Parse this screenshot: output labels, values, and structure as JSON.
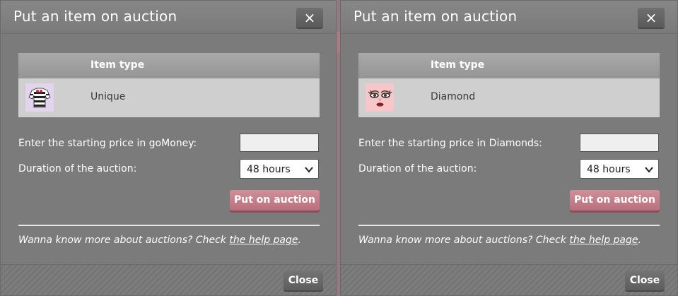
{
  "dialogs": [
    {
      "title": "Put an item on auction",
      "close_icon": "×",
      "table_header": "Item type",
      "item_type": "Unique",
      "item_icon": "striped-sweater-icon",
      "price_label": "Enter the starting price in goMoney:",
      "price_value": "",
      "duration_label": "Duration of the auction:",
      "duration_value": "48 hours",
      "auction_button": "Put on auction",
      "help_prefix": "Wanna know more about auctions? Check ",
      "help_link": "the help page",
      "help_suffix": ".",
      "close_button": "Close"
    },
    {
      "title": "Put an item on auction",
      "close_icon": "×",
      "table_header": "Item type",
      "item_type": "Diamond",
      "item_icon": "face-makeup-icon",
      "price_label": "Enter the starting price in Diamonds:",
      "price_value": "",
      "duration_label": "Duration of the auction:",
      "duration_value": "48 hours",
      "auction_button": "Put on auction",
      "help_prefix": "Wanna know more about auctions? Check ",
      "help_link": "the help page",
      "help_suffix": ".",
      "close_button": "Close"
    }
  ],
  "colors": {
    "dialog_bg": "#7b7b7b",
    "accent_button": "#c47f8b",
    "table_header_bg": "#a0a0a0",
    "table_row_bg": "#cfcfcf"
  }
}
